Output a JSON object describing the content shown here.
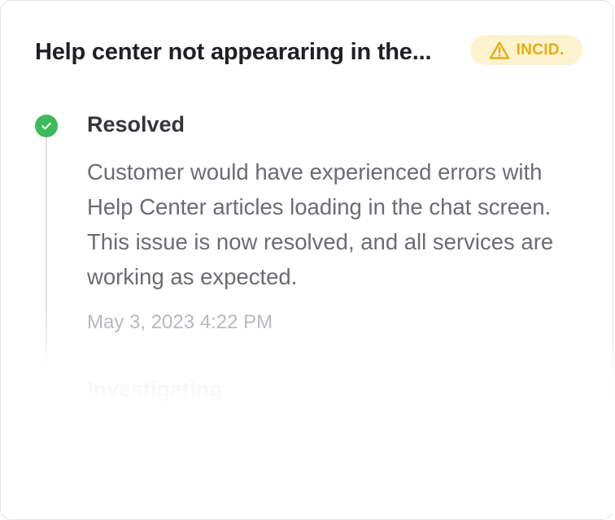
{
  "incident": {
    "title": "Help center not appeararing in the...",
    "badge": {
      "label": "INCID.",
      "icon": "warning-triangle-icon",
      "color": "#e8ad12",
      "background": "#fdf3cf"
    }
  },
  "updates": [
    {
      "status": "Resolved",
      "status_icon": "check-circle-icon",
      "status_color": "#3dba5a",
      "body": "Customer would have experienced errors with Help Center articles loading in the chat screen. This issue is now resolved, and all services are working as expected.",
      "timestamp": "May 3, 2023 4:22 PM"
    },
    {
      "status": "Investigating"
    }
  ]
}
